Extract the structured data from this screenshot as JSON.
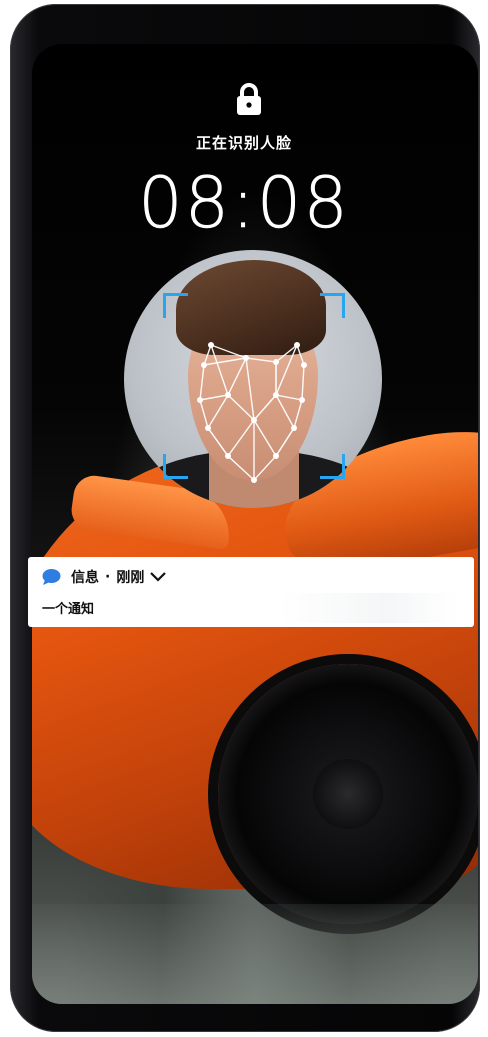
{
  "lock_screen": {
    "status_text": "正在识别人脸",
    "time": "08:08"
  },
  "icons": {
    "lock": "lock-icon",
    "message": "message-bubble-icon",
    "expand": "chevron-down-icon"
  },
  "notification": {
    "app_name": "信息",
    "separator": "·",
    "time": "刚刚",
    "body": "一个通知"
  },
  "colors": {
    "face_bracket": "#27a6ef",
    "message_icon": "#2f7de1",
    "car_accent": "#e2540f"
  }
}
